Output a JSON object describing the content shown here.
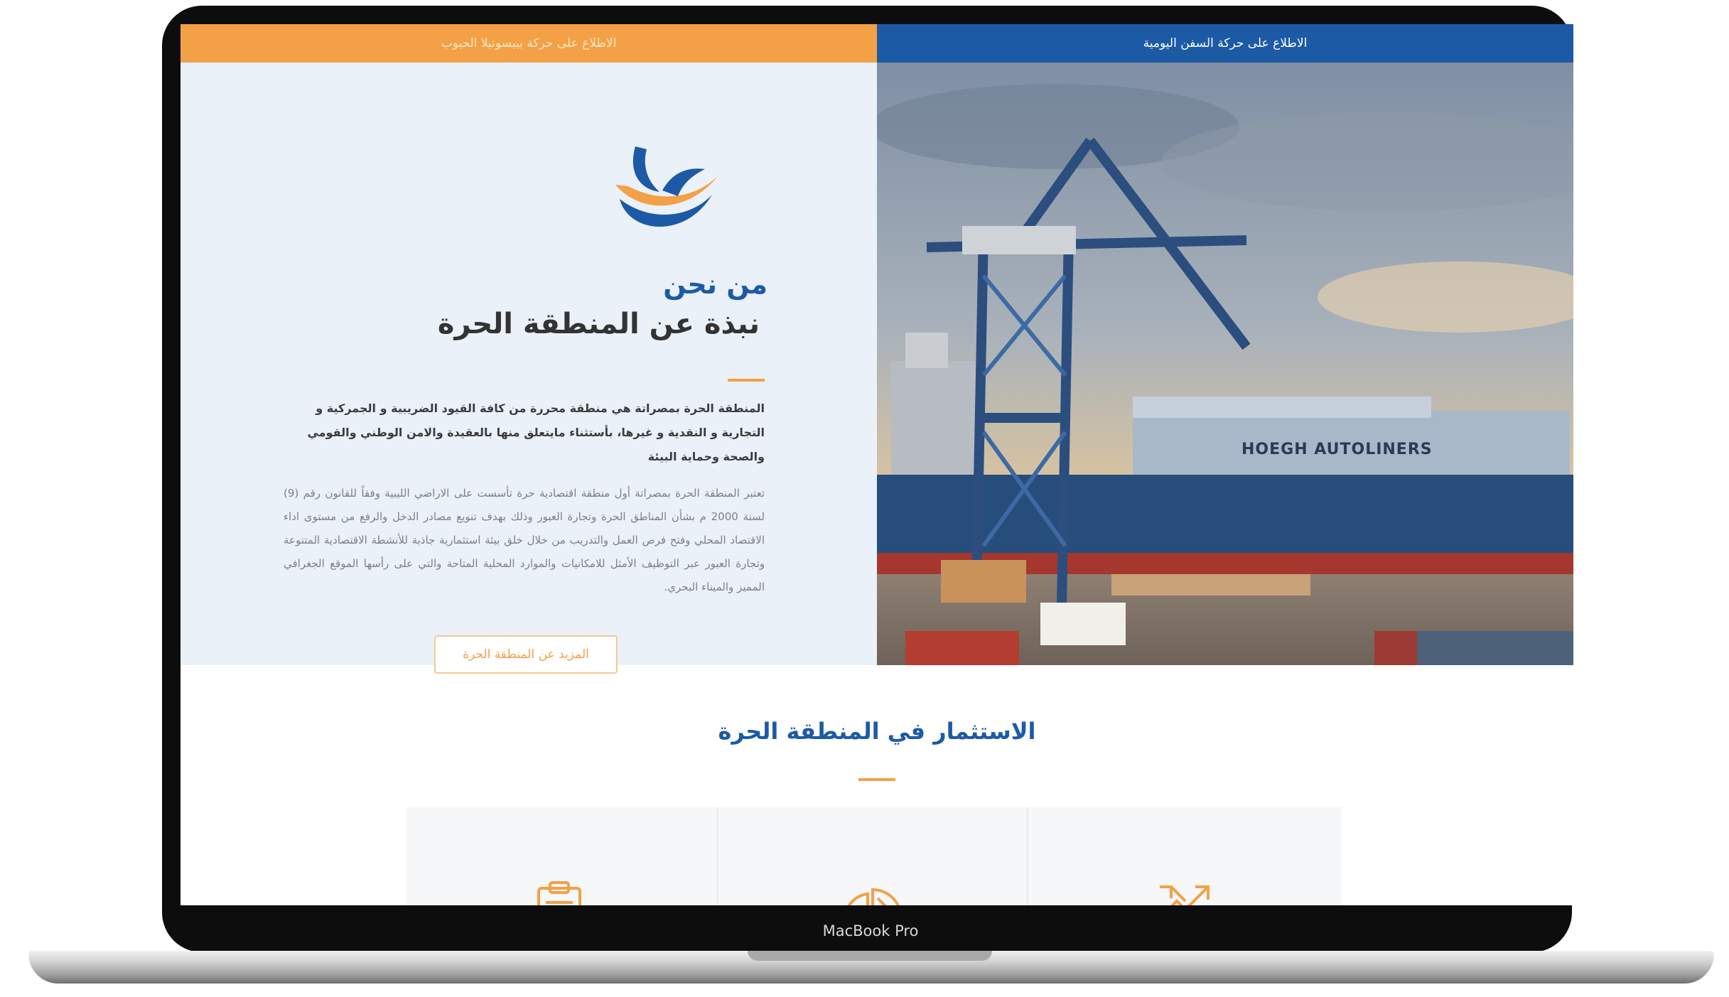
{
  "device": {
    "label": "MacBook Pro"
  },
  "top_bar": {
    "left_link": "الاطلاع على حركة بيبسوتيلا الحبوب",
    "right_link": "الاطلاع على حركة السفن اليومية"
  },
  "about": {
    "eyebrow": "من نحن",
    "title": "نبذة عن المنطقة الحرة",
    "lead": "المنطقة الحرة بمصراتة هي منطقة محررة من كافة القيود الضريبية و الجمركية و التجارية و النقدية و غيرها، بأستثناء مايتعلق منها بالعقيدة والامن الوطني والقومي والصحة وحماية البيئة",
    "body": "تعتبر المنطقة الحرة بمصراتة أول منطقة اقتصادية حرة تأسست على الاراضي الليبية وفقاً للقانون رقم (9) لسنة 2000 م بشأن المناطق الحرة وتجارة العبور وذلك بهدف تنويع مصادر الدخل والرفع من مستوى اداء الاقتصاد المحلي وفتح فرص العمل والتدريب من خلال خلق بيئة استثمارية جاذبة للأنشطة الاقتصادية المتنوعة وتجارة العبور عبر التوظيف الأمثل للامكانيات والموارد المحلية المتاحة والتي على رأسها الموقع الجغرافي المميز والميناء البحري.",
    "button": "المزيد عن المنطقة الحرة"
  },
  "photo": {
    "ship_text": "HOEGH AUTOLINERS"
  },
  "investment": {
    "title": "الاستثمار في المنطقة الحرة",
    "cards": [
      {
        "icon": "clipboard-icon"
      },
      {
        "icon": "pie-chart-icon"
      },
      {
        "icon": "growth-arrows-icon"
      }
    ]
  },
  "colors": {
    "brand_blue": "#1d5aa6",
    "brand_orange": "#f3a046",
    "about_bg": "#eaf1f9"
  }
}
